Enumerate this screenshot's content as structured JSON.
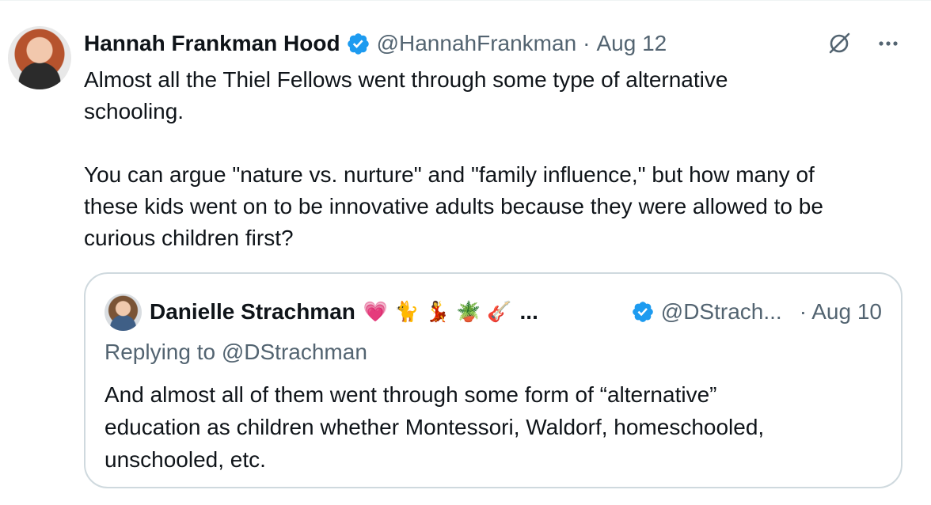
{
  "tweet": {
    "author_name": "Hannah Frankman Hood",
    "handle": "@HannahFrankman",
    "separator": "·",
    "date": "Aug 12",
    "text": "Almost all the Thiel Fellows went through some type of alternative\nschooling.\n\nYou can argue \"nature vs. nurture\" and \"family influence,\" but how many of\nthese kids went on to be innovative adults because they were allowed to be\ncurious children first?",
    "icons": [
      "avatar",
      "verified-badge-icon",
      "grok-icon",
      "more-icon"
    ]
  },
  "quoted_tweet": {
    "author_name": "Danielle Strachman",
    "emojis": "💗🐈💃🪴🎸",
    "ellipsis": "...",
    "handle": "@DStrach...",
    "date": "· Aug 10",
    "replying_to": "Replying to @DStrachman",
    "text": "And almost all of them went through some form of “alternative”\neducation as children whether Montessori, Waldorf, homeschooled,\nunschooled, etc."
  },
  "colors": {
    "primary_text": "#0f1419",
    "secondary_text": "#536471",
    "verified_blue": "#1d9bf0",
    "border": "#cfd9de"
  }
}
